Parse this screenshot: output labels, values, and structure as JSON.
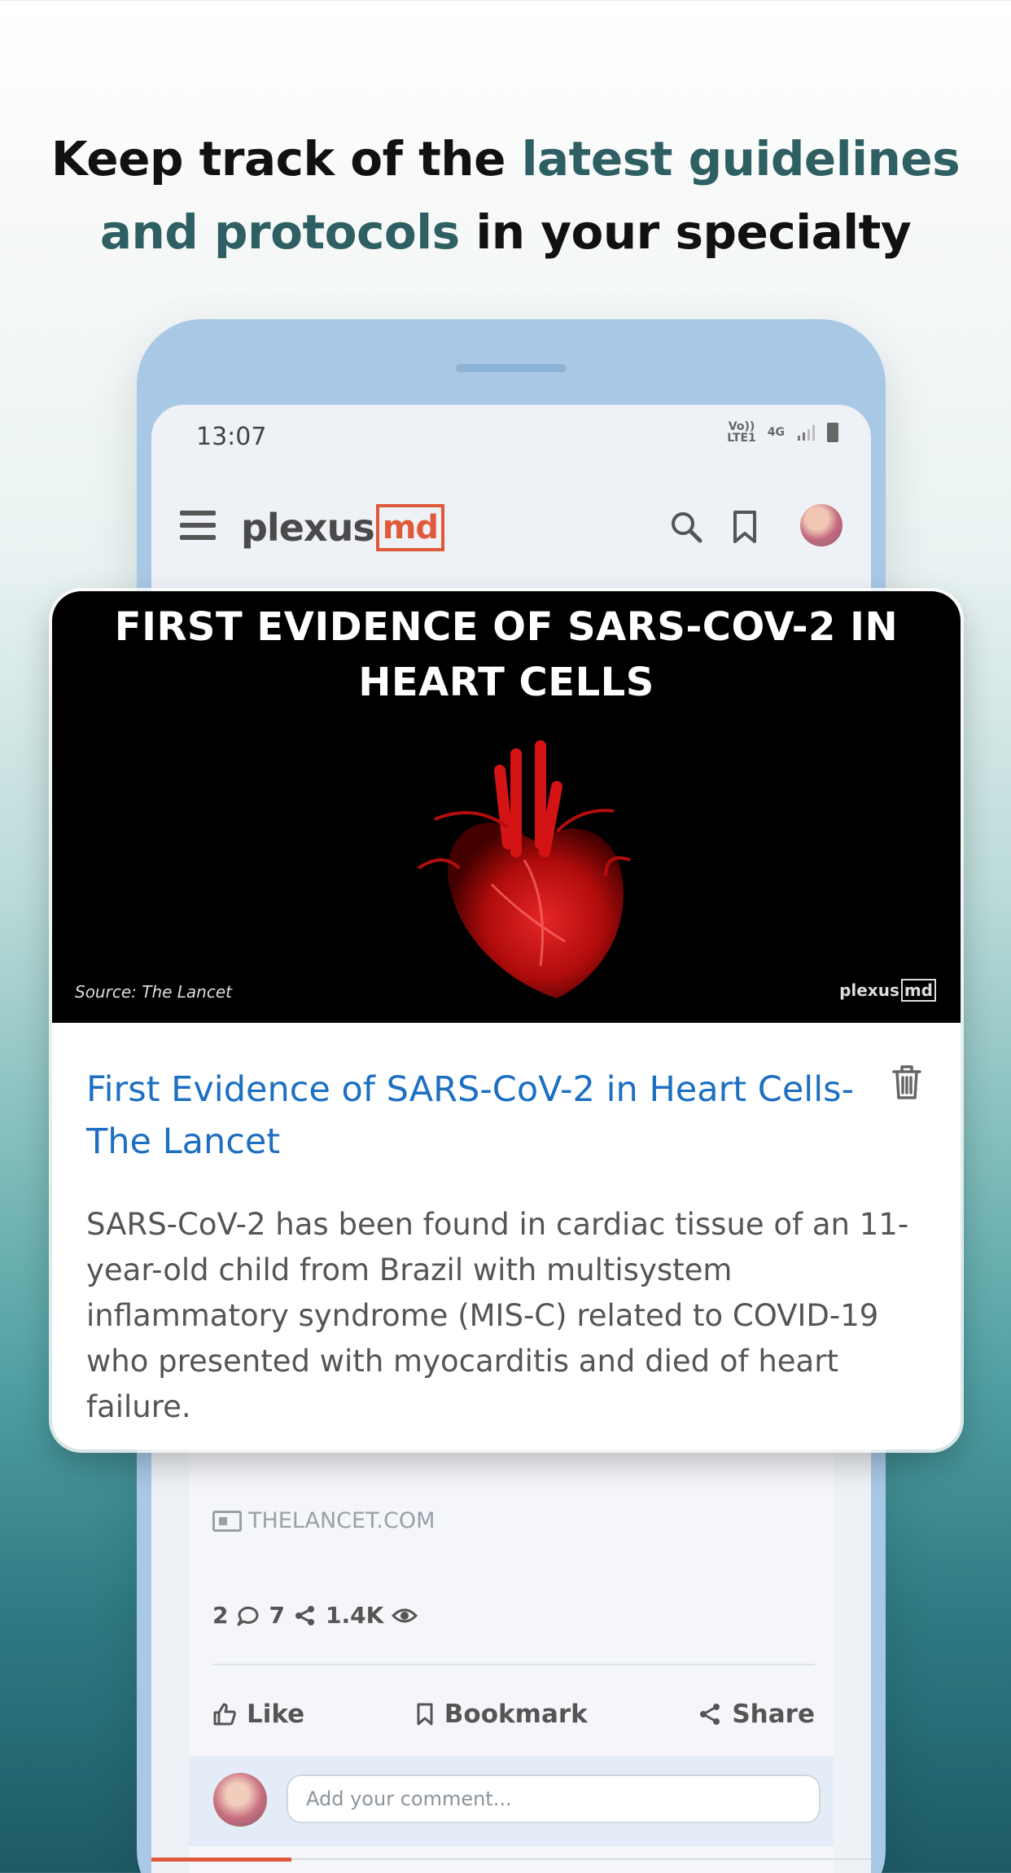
{
  "headline": {
    "part1": "Keep track of the ",
    "accent": "latest guidelines and protocols",
    "part2": " in your specialty"
  },
  "status_bar": {
    "time": "13:07",
    "network_top": "Vo))",
    "network_bottom": "LTE1",
    "signal": "4G"
  },
  "app_bar": {
    "logo_text": "plexus",
    "logo_md": "md"
  },
  "overlay_card": {
    "hero_title": "FIRST EVIDENCE OF SARS-COV-2 IN HEART CELLS",
    "hero_source": "Source: The Lancet",
    "hero_logo_text": "plexus",
    "hero_logo_md": "md",
    "title": "First Evidence of SARS-CoV-2 in Heart Cells- The Lancet",
    "excerpt": "SARS-CoV-2 has been found in cardiac tissue of an 11-year-old child from Brazil with multisystem inflammatory syndrome (MIS-C) related to COVID-19 who presented with myocarditis and died of heart failure."
  },
  "post": {
    "source": "THELANCET.COM",
    "comments_count": "2",
    "shares_count": "7",
    "views_count": "1.4K",
    "like_label": "Like",
    "bookmark_label": "Bookmark",
    "share_label": "Share",
    "comment_placeholder": "Add your comment..."
  },
  "colors": {
    "accent": "#2e5f62",
    "brand": "#e05a3a",
    "link": "#1c6fc1"
  }
}
